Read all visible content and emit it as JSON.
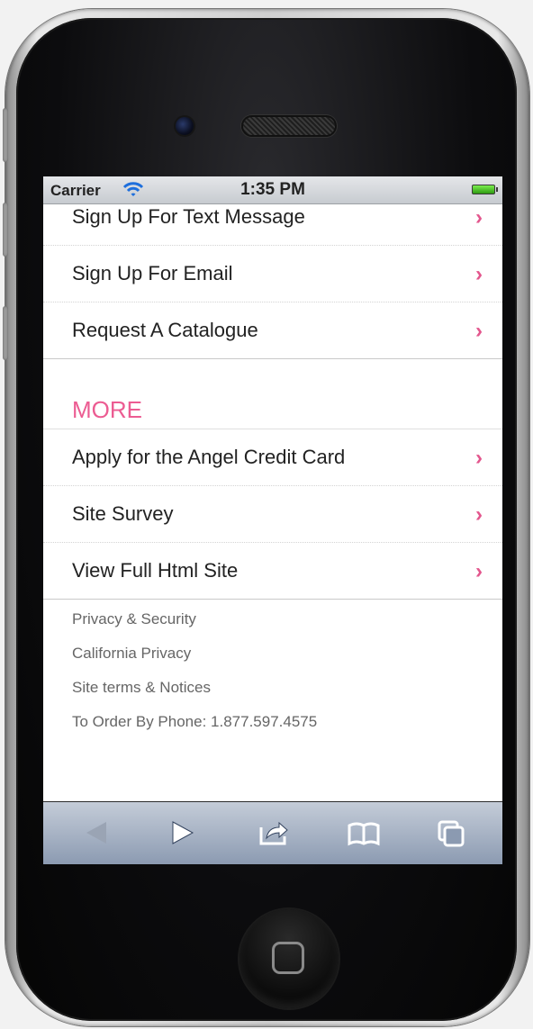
{
  "status_bar": {
    "carrier": "Carrier",
    "time": "1:35 PM"
  },
  "list_top": [
    {
      "label": "Sign Up For Text Message"
    },
    {
      "label": "Sign Up For Email"
    },
    {
      "label": "Request A Catalogue"
    }
  ],
  "more_section": {
    "title": "MORE",
    "items": [
      {
        "label": "Apply for the Angel Credit Card"
      },
      {
        "label": "Site Survey"
      },
      {
        "label": "View Full Html Site"
      }
    ]
  },
  "footer": {
    "links": [
      "Privacy & Security",
      "California Privacy",
      "Site terms & Notices"
    ],
    "phone": "To Order By Phone: 1.877.597.4575"
  },
  "toolbar": {
    "items": [
      "back-icon",
      "forward-icon",
      "share-icon",
      "bookmarks-icon",
      "tabs-icon"
    ]
  },
  "colors": {
    "accent_pink": "#e3568d",
    "header_pink": "#ec5c92",
    "toolbar_blue": "#8b9ab1"
  }
}
